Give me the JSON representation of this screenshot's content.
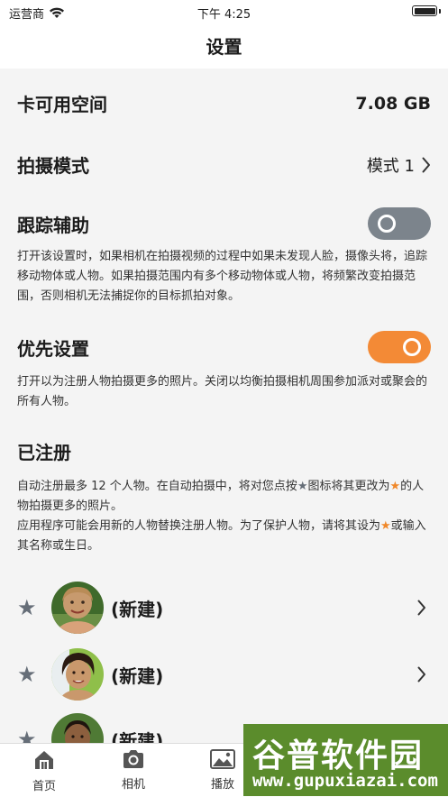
{
  "status_bar": {
    "carrier": "运营商",
    "time": "下午 4:25"
  },
  "nav": {
    "title": "设置"
  },
  "storage": {
    "label": "卡可用空间",
    "value": "7.08 GB"
  },
  "shoot_mode": {
    "label": "拍摄模式",
    "value": "模式 1"
  },
  "tracking": {
    "label": "跟踪辅助",
    "enabled": false,
    "description": "打开该设置时，如果相机在拍摄视频的过程中如果未发现人脸，摄像头将，追踪移动物体或人物。如果拍摄范围内有多个移动物体或人物，将频繁改变拍摄范围，否则相机无法捕捉你的目标抓拍对象。"
  },
  "priority": {
    "label": "优先设置",
    "enabled": true,
    "description": "打开以为注册人物拍摄更多的照片。关闭以均衡拍摄相机周围参加派对或聚会的所有人物。"
  },
  "registered": {
    "title": "已注册",
    "desc_1a": "自动注册最多 12 个人物。在自动拍摄中，将对您点按",
    "desc_1b": "图标将其更改为",
    "desc_1c": "的人物拍摄更多的照片。",
    "desc_2a": "应用程序可能会用新的人物替换注册人物。为了保护人物，请将其设为",
    "desc_2b": "或输入其名称或生日。",
    "star": "★",
    "people": [
      {
        "name": "(新建)"
      },
      {
        "name": "(新建)"
      },
      {
        "name": "(新建)"
      }
    ]
  },
  "tabs": [
    {
      "label": "首页",
      "icon": "home-icon"
    },
    {
      "label": "相机",
      "icon": "camera-icon"
    },
    {
      "label": "播放",
      "icon": "photo-icon"
    }
  ],
  "watermark": {
    "text": "谷普软件园",
    "url": "www.gupuxiazai.com"
  },
  "colors": {
    "accent": "#f38a36",
    "toggle_off": "#7c848c",
    "star_grey": "#666e78"
  }
}
